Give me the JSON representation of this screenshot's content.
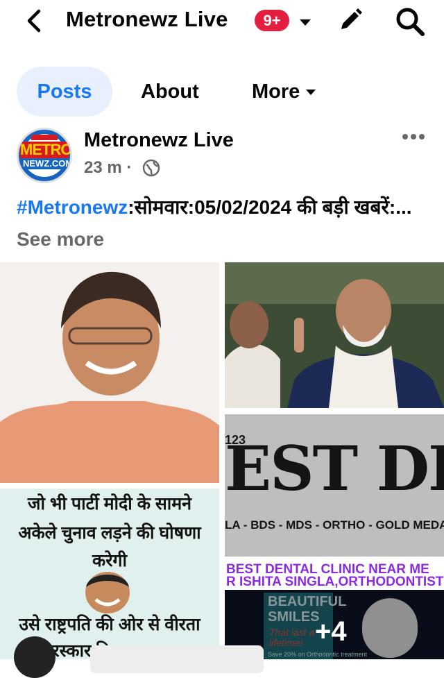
{
  "header": {
    "title": "Metronewz Live",
    "notification_count": "9+",
    "icons": [
      "back-arrow-icon",
      "caret-down-icon",
      "edit-pencil-icon",
      "search-icon"
    ]
  },
  "tabs": [
    {
      "label": "Posts",
      "active": true
    },
    {
      "label": "About",
      "active": false
    },
    {
      "label": "More",
      "active": false
    }
  ],
  "post": {
    "avatar_logo": {
      "top": "METRO",
      "bottom": "NEWZ.COM"
    },
    "author": "Metronewz Live",
    "time": "23 m",
    "separator": "·",
    "hashtag": "#Metronewz",
    "text": ":सोमवार:05/02/2024 की बड़ी खबरें:...",
    "see_more": "See more",
    "photos": {
      "dental_sign": {
        "number": "123",
        "big_text": "EST DENT",
        "subtitle": "LA - BDS - MDS - ORTHO - GOLD MEDALIST"
      },
      "meme": {
        "line1": "जो भी पार्टी मोदी के सामने",
        "line2": "अकेले चुनाव लड़ने की घोषणा",
        "line3": "करेगी",
        "line4": "उसे राष्ट्रपति की ओर से वीरता",
        "line5": "पुरस्कार दिया जाएगा।"
      },
      "dental_ad": {
        "banner1": "BEST DENTAL CLINIC NEAR ME",
        "banner2": "R ISHITA SINGLA,ORTHODONTIST",
        "headline1": "BEAUTIFUL",
        "headline2": "SMILES",
        "tagline": "That last a lifetime!",
        "footer": "Save 20% on Orthodontic treatment"
      },
      "more_count": "+4"
    }
  },
  "colors": {
    "accent": "#1877f2",
    "badge": "#e41e3f",
    "tab_active_bg": "#e7f0fc",
    "muted": "#65676b"
  }
}
